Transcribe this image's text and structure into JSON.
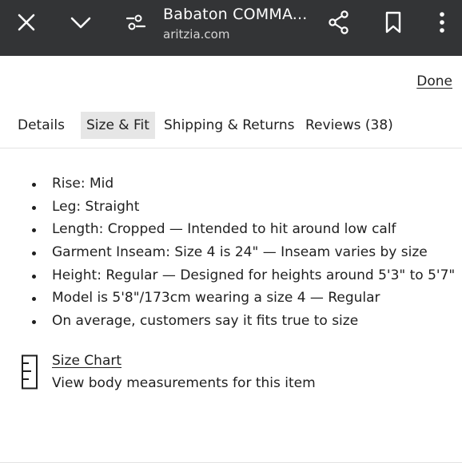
{
  "browser": {
    "title": "Babaton COMMA...",
    "domain": "aritzia.com",
    "icons": [
      "close-icon",
      "chevron-down-icon",
      "tune-icon",
      "share-icon",
      "bookmark-icon",
      "more-vert-icon"
    ]
  },
  "panel": {
    "done_label": "Done",
    "tabs": [
      {
        "label": "Details",
        "active": false
      },
      {
        "label": "Size & Fit",
        "active": true
      },
      {
        "label": "Shipping & Returns",
        "active": false
      },
      {
        "label": "Reviews (38)",
        "active": false
      }
    ],
    "fit_items": [
      "Rise: Mid",
      "Leg: Straight",
      "Length: Cropped — Intended to hit around low calf",
      "Garment Inseam: Size 4 is 24\" — Inseam varies by size",
      "Height: Regular — Designed for heights around 5'3\" to 5'7\"",
      "Model is 5'8\"/173cm wearing a size 4  —  Regular",
      "On average, customers say it fits true to size"
    ],
    "size_chart": {
      "link_label": "Size Chart",
      "description": "View body measurements for this item",
      "icon": "ruler-icon"
    }
  },
  "colors": {
    "topbar": "#333436",
    "active_tab_bg": "#e6e6e6",
    "text": "#1f1f1f"
  }
}
